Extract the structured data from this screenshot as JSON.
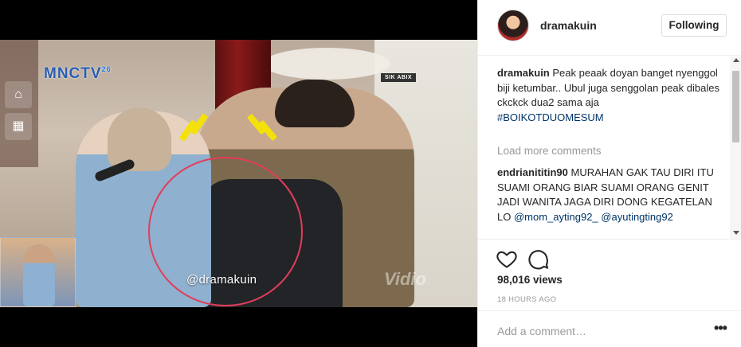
{
  "video": {
    "logo": "MNCTV",
    "logo_suffix": "26",
    "corner_chip": "SIK ABIX",
    "watermark": "@dramakuin",
    "brand": "Vidio",
    "side_icons": [
      "home-icon",
      "trash-icon"
    ]
  },
  "post": {
    "username": "dramakuin",
    "follow_label": "Following"
  },
  "comments": [
    {
      "username": "dramakuin",
      "text": "Peak peaak doyan banget nyenggol biji ketumbar.. Ubul juga senggolan peak dibales ckckck dua2 sama aja",
      "hashtag": "#BOIKOTDUOMESUM"
    },
    {
      "username": "endrianititin90",
      "text": "MURAHAN GAK TAU DIRI ITU SUAMI ORANG BIAR SUAMI ORANG GENIT JADI WANITA JAGA DIRI DONG KEGATELAN LO",
      "mention1": "@mom_ayting92_",
      "mention2": "@ayutingting92"
    }
  ],
  "load_more": "Load more comments",
  "actions": {
    "views": "98,016 views",
    "time": "18 HOURS AGO",
    "icons": [
      "heart-icon",
      "comment-icon"
    ]
  },
  "add_comment": {
    "placeholder": "Add a comment…",
    "more": "•••"
  },
  "colors": {
    "link": "#003569",
    "muted": "#999999",
    "circle": "#e23d5a",
    "accent_yellow": "#f4e10a"
  }
}
